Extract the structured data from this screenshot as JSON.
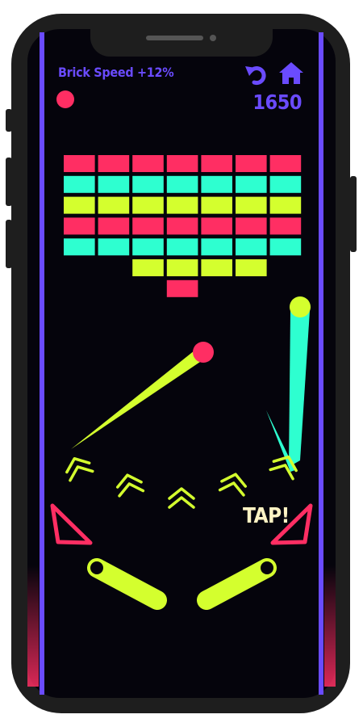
{
  "hud": {
    "modifier_text": "Brick Speed +12%",
    "score": "1650",
    "lives": 1,
    "restart_icon": "restart-icon",
    "home_icon": "home-icon"
  },
  "prompt": {
    "tap_text": "TAP!"
  },
  "colors": {
    "accent": "#6a4bff",
    "pink": "#ff2e63",
    "cyan": "#2effd0",
    "lime": "#d4ff2e",
    "background": "#05040c"
  },
  "bricks": {
    "rows": [
      [
        "pink",
        "pink",
        "pink",
        "pink",
        "pink",
        "pink",
        "pink"
      ],
      [
        "cyan",
        "cyan",
        "cyan",
        "cyan",
        "cyan",
        "cyan",
        "cyan"
      ],
      [
        "lime",
        "lime",
        "lime",
        "lime",
        "lime",
        "lime",
        "lime"
      ],
      [
        "pink",
        "pink",
        "pink",
        "pink",
        "pink",
        "pink",
        "pink"
      ],
      [
        "cyan",
        "cyan",
        "cyan",
        "cyan",
        "cyan",
        "cyan",
        "cyan"
      ],
      [
        null,
        null,
        "lime",
        "lime",
        "lime",
        "lime",
        null
      ],
      [
        null,
        null,
        null,
        "pink",
        null,
        null,
        null
      ]
    ]
  }
}
